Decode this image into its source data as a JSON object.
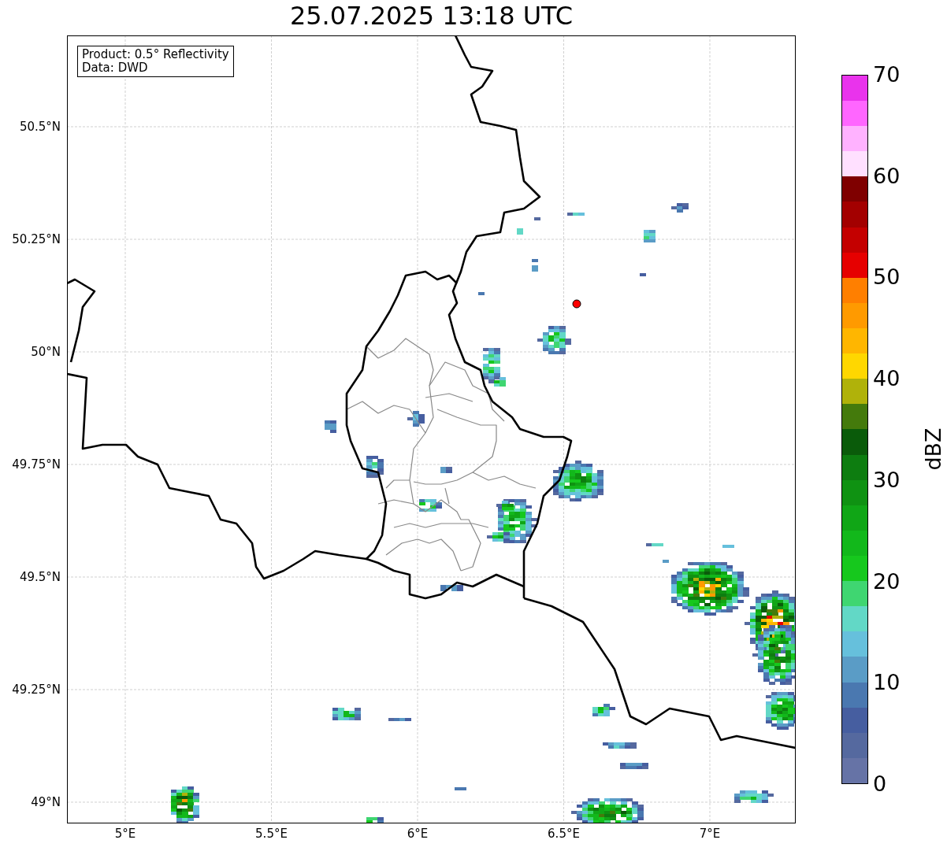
{
  "title": "25.07.2025 13:18 UTC",
  "info_box": [
    "Product: 0.5° Reflectivity",
    "Data: DWD"
  ],
  "map": {
    "lat_ticks": [
      "50.5°N",
      "50.25°N",
      "50°N",
      "49.75°N",
      "49.5°N",
      "49.25°N",
      "49°N"
    ],
    "lon_ticks": [
      "5°E",
      "5.5°E",
      "6°E",
      "6.5°E",
      "7°E"
    ]
  },
  "colorbar": {
    "label": "dBZ",
    "ticks": [
      "70",
      "60",
      "50",
      "40",
      "30",
      "20",
      "10",
      "0"
    ],
    "segments": [
      {
        "color": "#6673a6"
      },
      {
        "color": "#55699f"
      },
      {
        "color": "#465ea0"
      },
      {
        "color": "#4a78b0"
      },
      {
        "color": "#5a9cc6"
      },
      {
        "color": "#66c0dc"
      },
      {
        "color": "#62d8c6"
      },
      {
        "color": "#3fd671"
      },
      {
        "color": "#16c81d"
      },
      {
        "color": "#12b81b"
      },
      {
        "color": "#10a616"
      },
      {
        "color": "#0f9212"
      },
      {
        "color": "#0d7d10"
      },
      {
        "color": "#0a5b0a"
      },
      {
        "color": "#447a0c"
      },
      {
        "color": "#b0b20a"
      },
      {
        "color": "#ffd700"
      },
      {
        "color": "#ffb600"
      },
      {
        "color": "#ff9a00"
      },
      {
        "color": "#ff7f00"
      },
      {
        "color": "#e60000"
      },
      {
        "color": "#c40000"
      },
      {
        "color": "#a30000"
      },
      {
        "color": "#7f0000"
      },
      {
        "color": "#ffe0ff"
      },
      {
        "color": "#ffb2ff"
      },
      {
        "color": "#ff66ff"
      },
      {
        "color": "#e933ec"
      }
    ]
  }
}
